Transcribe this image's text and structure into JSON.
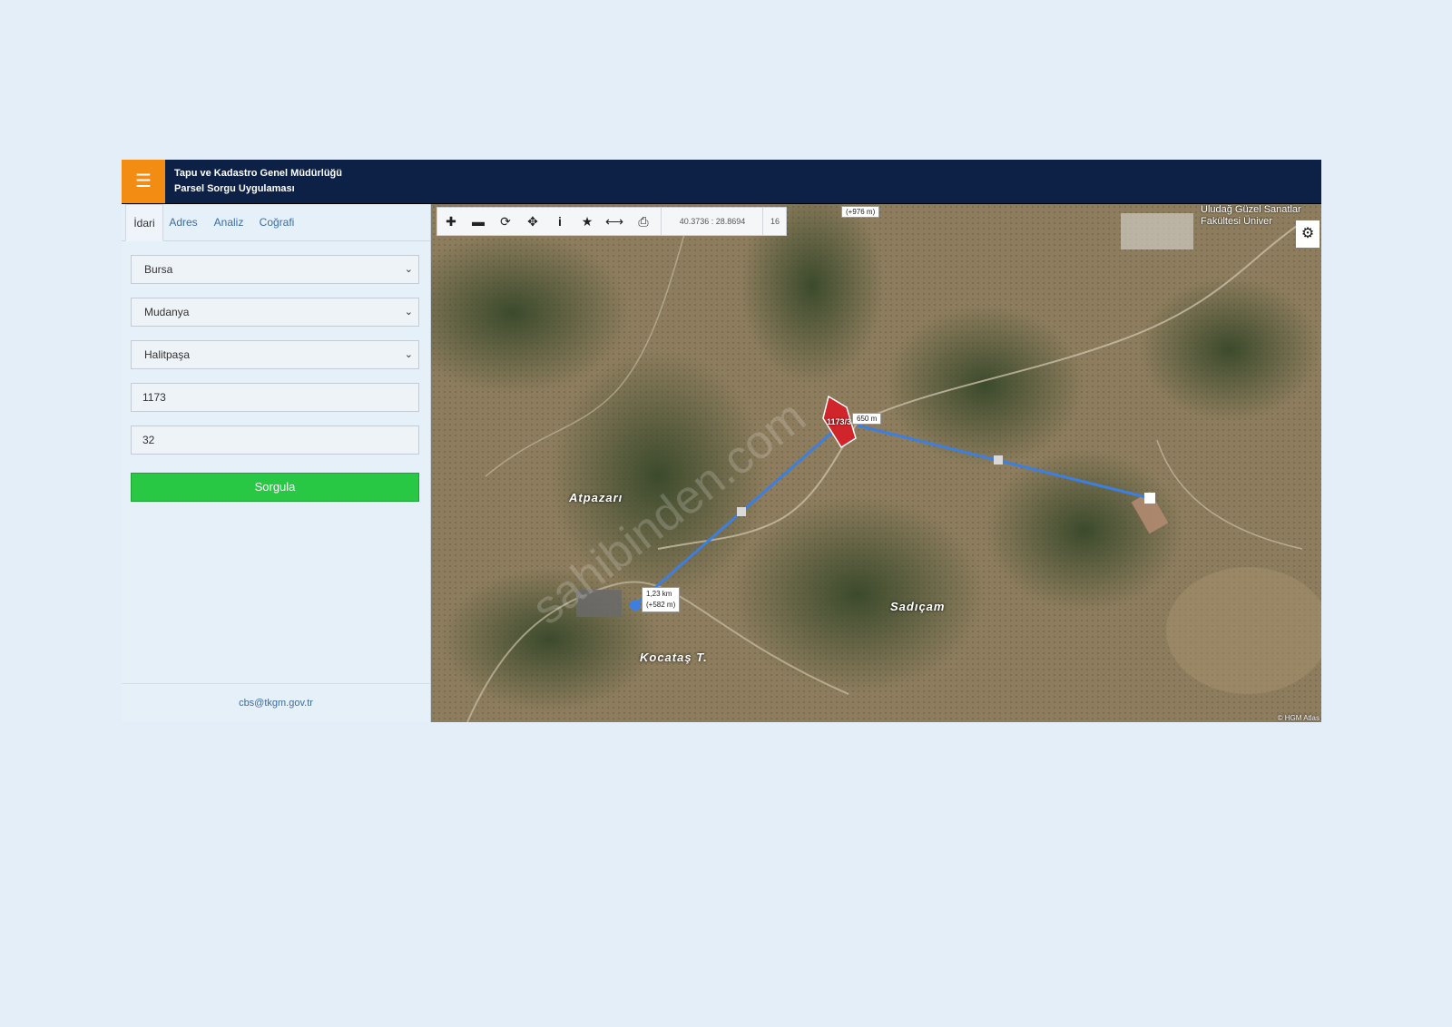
{
  "header": {
    "menu_icon": "hamburger-icon",
    "title_line1": "Tapu ve Kadastro Genel Müdürlüğü",
    "title_line2": "Parsel Sorgu Uygulaması",
    "accent_color": "#f28c13",
    "bar_color": "#0d2147"
  },
  "sidebar": {
    "tabs": [
      {
        "label": "İdari",
        "active": true
      },
      {
        "label": "Adres",
        "active": false
      },
      {
        "label": "Analiz",
        "active": false
      },
      {
        "label": "Coğrafi",
        "active": false
      }
    ],
    "province": "Bursa",
    "district": "Mudanya",
    "neighborhood": "Halitpaşa",
    "block_no": "1173",
    "parcel_no": "32",
    "query_button": "Sorgula",
    "query_button_color": "#28c844",
    "footer_email": "cbs@tkgm.gov.tr"
  },
  "map": {
    "toolbar": {
      "tools": [
        "zoom-in-icon",
        "zoom-out-icon",
        "refresh-icon",
        "locate-icon",
        "info-icon",
        "star-icon",
        "measure-icon",
        "print-icon"
      ],
      "coordinates": "40.3736 : 28.8694",
      "zoom_level": "16"
    },
    "top_tip": "(+976 m)",
    "parcel_label": "1173/3",
    "measure_tip_1": "650 m",
    "measure_tip_2_line1": "1,23 km",
    "measure_tip_2_line2": "(+582 m)",
    "places": [
      "Atpazarı",
      "Sadıçam",
      "Kocataş T."
    ],
    "poi_line1": "Uludağ Güzel Sanatlar",
    "poi_line2": "Fakültesi Üniver",
    "attribution": "© HGM Atlas",
    "watermark": "sahibinden.com",
    "measure_line_color": "#3d7fe0",
    "parcel_color": "#d0262b"
  }
}
